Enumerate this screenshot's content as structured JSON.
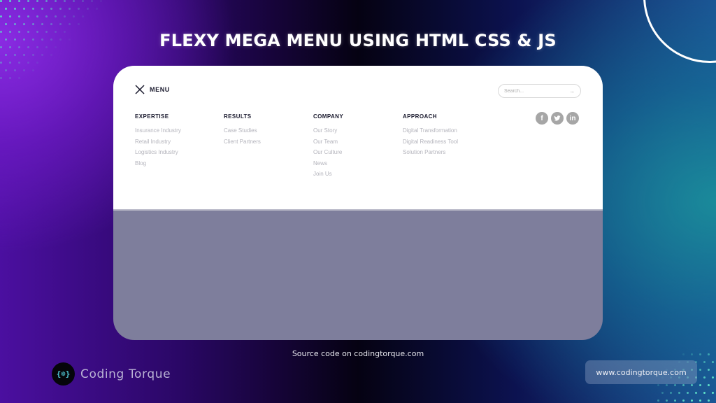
{
  "banner": {
    "title": "FLEXY MEGA MENU USING HTML CSS & JS",
    "source_note": "Source code on codingtorque.com",
    "brand_name": "Coding Torque",
    "brand_logo_glyph": "{☸}",
    "website_button": "www.codingtorque.com"
  },
  "menu": {
    "close_label": "MENU",
    "close_icon": "close-x-icon",
    "search": {
      "placeholder": "Search...",
      "value": "",
      "arrow": "→"
    },
    "columns": [
      {
        "heading": "EXPERTISE",
        "links": [
          "Insurance Industry",
          "Retail Industry",
          "Logistics Industry",
          "Blog"
        ]
      },
      {
        "heading": "RESULTS",
        "links": [
          "Case Studies",
          "Client Partners"
        ]
      },
      {
        "heading": "COMPANY",
        "links": [
          "Our Story",
          "Our Team",
          "Our Culture",
          "News",
          "Join Us"
        ]
      },
      {
        "heading": "APPROACH",
        "links": [
          "Digital Transformation",
          "Digital Readiness Tool",
          "Solution Partners"
        ]
      }
    ],
    "social": [
      {
        "name": "facebook",
        "glyph": "f"
      },
      {
        "name": "twitter",
        "glyph": "t"
      },
      {
        "name": "linkedin",
        "glyph": "in"
      }
    ]
  },
  "colors": {
    "overlay": "#7e7e9c",
    "heading": "#1a1a2e",
    "link": "#b4b4bc",
    "social_icon": "#a6a6a6",
    "dot_accent": "#5ee0c8"
  }
}
